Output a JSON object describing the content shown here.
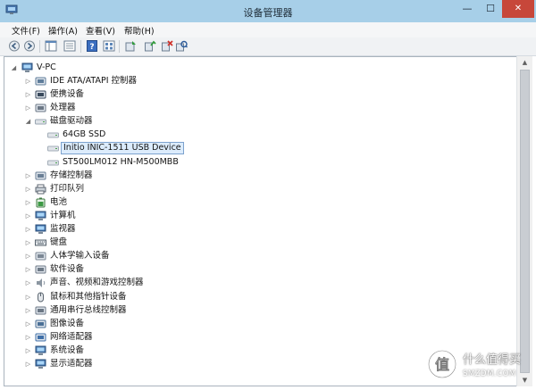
{
  "window": {
    "title": "设备管理器",
    "minimize": "—",
    "maximize": "☐",
    "close": "✕"
  },
  "menu": [
    {
      "label": "文件(F)"
    },
    {
      "label": "操作(A)"
    },
    {
      "label": "查看(V)"
    },
    {
      "label": "帮助(H)"
    }
  ],
  "toolbar": {
    "buttons": [
      "back-icon",
      "forward-icon",
      "show-hide-console-tree-icon",
      "properties-icon",
      "help-icon",
      "show-all-icon",
      "update-driver-icon",
      "disable-device-icon",
      "uninstall-device-icon",
      "scan-hardware-icon"
    ]
  },
  "tree": {
    "root": "V-PC",
    "categories": [
      {
        "label": "IDE ATA/ATAPI 控制器",
        "icon": "ide-controller-icon"
      },
      {
        "label": "便携设备",
        "icon": "portable-device-icon"
      },
      {
        "label": "处理器",
        "icon": "processor-icon"
      },
      {
        "label": "磁盘驱动器",
        "icon": "disk-drive-icon",
        "expanded": true,
        "children": [
          {
            "label": "64GB SSD",
            "icon": "disk-icon"
          },
          {
            "label": "Initio INIC-1511 USB Device",
            "icon": "disk-icon",
            "selected": true
          },
          {
            "label": "ST500LM012 HN-M500MBB",
            "icon": "disk-icon"
          }
        ]
      },
      {
        "label": "存储控制器",
        "icon": "storage-controller-icon"
      },
      {
        "label": "打印队列",
        "icon": "printer-icon"
      },
      {
        "label": "电池",
        "icon": "battery-icon"
      },
      {
        "label": "计算机",
        "icon": "computer-icon"
      },
      {
        "label": "监视器",
        "icon": "monitor-icon"
      },
      {
        "label": "键盘",
        "icon": "keyboard-icon"
      },
      {
        "label": "人体学输入设备",
        "icon": "hid-icon"
      },
      {
        "label": "软件设备",
        "icon": "software-device-icon"
      },
      {
        "label": "声音、视频和游戏控制器",
        "icon": "sound-icon"
      },
      {
        "label": "鼠标和其他指针设备",
        "icon": "mouse-icon"
      },
      {
        "label": "通用串行总线控制器",
        "icon": "usb-icon"
      },
      {
        "label": "图像设备",
        "icon": "imaging-device-icon"
      },
      {
        "label": "网络适配器",
        "icon": "network-adapter-icon"
      },
      {
        "label": "系统设备",
        "icon": "system-device-icon"
      },
      {
        "label": "显示适配器",
        "icon": "display-adapter-icon"
      }
    ]
  },
  "watermark": {
    "text_cn": "什么值得买",
    "text_en": "SMZDM.COM"
  },
  "colors": {
    "titlebar": "#a7cfe8",
    "close_button": "#c7473a",
    "selection": "#dcecfc",
    "selection_border": "#7da2ce"
  }
}
